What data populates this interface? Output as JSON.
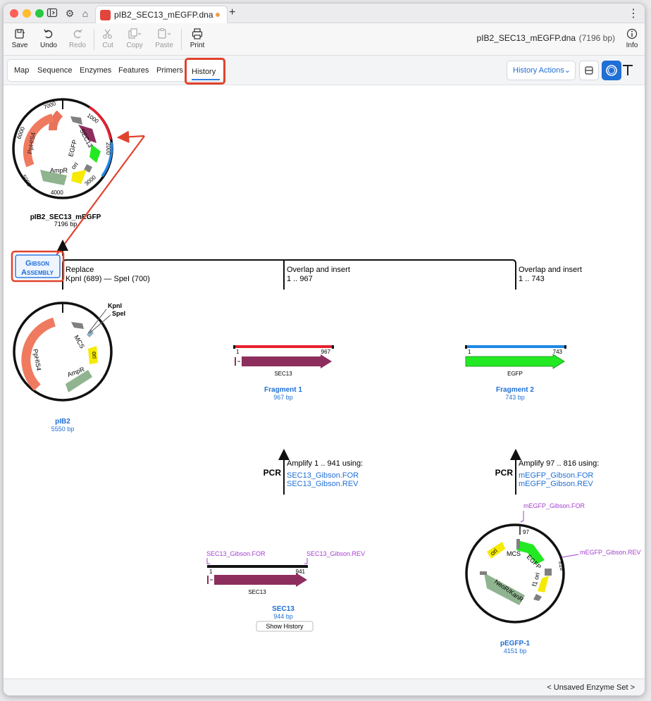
{
  "window": {
    "tab_title": "pIB2_SEC13_mEGFP.dna",
    "new_tab": "+",
    "more_menu": "⋮"
  },
  "toolbar": {
    "save": "Save",
    "undo": "Undo",
    "redo": "Redo",
    "cut": "Cut",
    "copy": "Copy",
    "paste": "Paste",
    "print": "Print",
    "info": "Info",
    "file_name": "pIB2_SEC13_mEGFP.dna",
    "file_size": "(7196 bp)"
  },
  "view_tabs": [
    "Map",
    "Sequence",
    "Enzymes",
    "Features",
    "Primers",
    "History"
  ],
  "history_actions": "History Actions",
  "status": {
    "enzyme_set": "< Unsaved Enzyme Set >"
  },
  "colors": {
    "accent": "#1f6fd6",
    "callout": "#e0432d",
    "feature_purple": "#8e2e5e",
    "feature_green": "#23e923",
    "primer": "#a23fd0"
  },
  "history": {
    "product": {
      "name": "pIB2_SEC13_mEGFP",
      "size": "7196 bp",
      "ticks": [
        "1000",
        "2000",
        "3000",
        "4000",
        "5000",
        "6000",
        "7000"
      ],
      "features": [
        "SEC13",
        "EGFP",
        "PpHIS4",
        "AmpR",
        "ori"
      ]
    },
    "operation": {
      "label_line1": "Gibson",
      "label_line2": "Assembly"
    },
    "branches": [
      {
        "action": "Replace",
        "detail": "KpnI (689)  —  SpeI (700)"
      },
      {
        "action": "Overlap and insert",
        "detail": "1 .. 967"
      },
      {
        "action": "Overlap and insert",
        "detail": "1 .. 743"
      }
    ],
    "pib2": {
      "name": "pIB2",
      "size": "5550 bp",
      "sites": [
        "KpnI",
        "SpeI"
      ],
      "features": [
        "MCS",
        "ori",
        "PpHIS4",
        "AmpR"
      ]
    },
    "fragment1": {
      "name": "Fragment 1",
      "size": "967 bp",
      "start": "1",
      "end": "967",
      "feature": "SEC13"
    },
    "fragment2": {
      "name": "Fragment 2",
      "size": "743 bp",
      "start": "1",
      "end": "743",
      "feature": "EGFP"
    },
    "pcr1": {
      "label": "PCR",
      "title": "Amplify 1 .. 941 using:",
      "primers": [
        "SEC13_Gibson.FOR",
        "SEC13_Gibson.REV"
      ]
    },
    "pcr2": {
      "label": "PCR",
      "title": "Amplify 97 .. 816 using:",
      "primers": [
        "mEGFP_Gibson.FOR",
        "mEGFP_Gibson.REV"
      ]
    },
    "sec13": {
      "name": "SEC13",
      "size": "944 bp",
      "start": "1",
      "end": "941",
      "feature": "SEC13",
      "primer_for": "SEC13_Gibson.FOR",
      "primer_rev": "SEC13_Gibson.REV",
      "button": "Show History"
    },
    "pegfp": {
      "name": "pEGFP-1",
      "size": "4151 bp",
      "start": "97",
      "end": "816",
      "primer_for": "mEGFP_Gibson.FOR",
      "primer_rev": "mEGFP_Gibson.REV",
      "features": [
        "ori",
        "MCS",
        "EGFP",
        "f1 ori",
        "NeoR/KanR"
      ]
    }
  }
}
